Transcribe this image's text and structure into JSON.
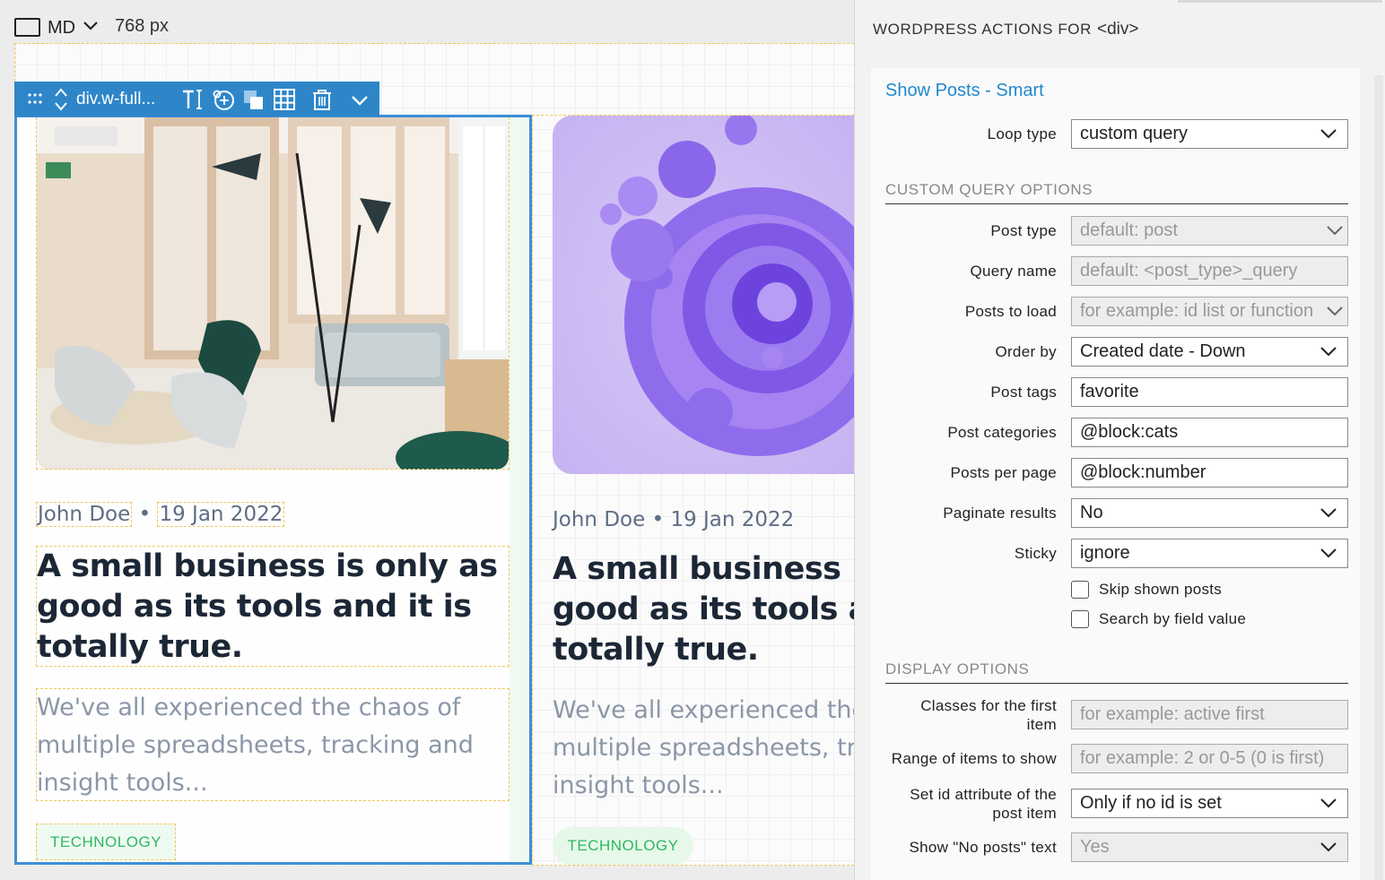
{
  "device": {
    "label": "MD",
    "width": "768 px"
  },
  "toolbar": {
    "element_name": "div.w-full..."
  },
  "cards": [
    {
      "author": "John Doe",
      "sep": "•",
      "date": "19 Jan 2022",
      "title": "A small business is only as good as its tools and it is totally true.",
      "excerpt": "We've all experienced the chaos of multiple spreadsheets, tracking and insight tools...",
      "tag": "TECHNOLOGY"
    },
    {
      "meta": "John Doe • 19 Jan 2022",
      "title_lines": [
        "A small business is only as",
        "good as its tools and it is",
        "totally true."
      ],
      "excerpt_lines": [
        "We've all experienced the chaos of",
        "multiple spreadsheets, tracking and",
        "insight tools..."
      ],
      "tag": "TECHNOLOGY"
    }
  ],
  "panel": {
    "heading": "WORDPRESS ACTIONS FOR",
    "tag_name": "<div>",
    "action": "Show Posts - Smart",
    "loop_type": {
      "label": "Loop type",
      "value": "custom query"
    },
    "custom_section": "CUSTOM QUERY OPTIONS",
    "post_type": {
      "label": "Post type",
      "placeholder": "default: post"
    },
    "query_name": {
      "label": "Query name",
      "placeholder": "default: <post_type>_query"
    },
    "posts_to_load": {
      "label": "Posts to load",
      "placeholder": "for example: id list or function"
    },
    "order_by": {
      "label": "Order by",
      "value": "Created date - Down"
    },
    "post_tags": {
      "label": "Post tags",
      "value": "favorite"
    },
    "post_categories": {
      "label": "Post categories",
      "value": "@block:cats"
    },
    "posts_per_page": {
      "label": "Posts per page",
      "value": "@block:number"
    },
    "paginate": {
      "label": "Paginate results",
      "value": "No"
    },
    "sticky": {
      "label": "Sticky",
      "value": "ignore"
    },
    "skip_shown": "Skip shown posts",
    "search_field": "Search by field value",
    "display_section": "DISPLAY OPTIONS",
    "classes_first": {
      "label_1": "Classes for the first",
      "label_2": "item",
      "placeholder": "for example: active first"
    },
    "range_items": {
      "label": "Range of items to show",
      "placeholder": "for example: 2 or 0-5 (0 is first)"
    },
    "set_id": {
      "label_1": "Set id attribute of the",
      "label_2": "post item",
      "value": "Only if no id is set"
    },
    "no_posts": {
      "label": "Show \"No posts\" text",
      "value": "Yes"
    }
  },
  "colors": {
    "accent": "#2e86c9",
    "link": "#2288cc",
    "tag_green": "#2eb860",
    "guide_dash": "#f0c75b"
  }
}
